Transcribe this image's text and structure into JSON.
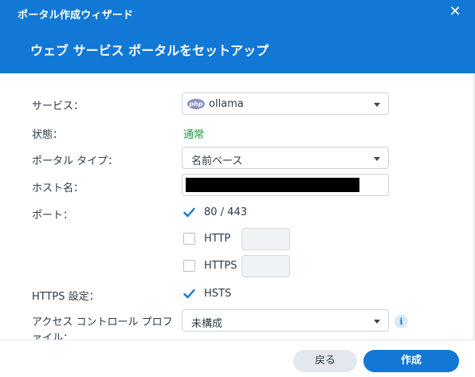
{
  "window": {
    "title": "ポータル作成ウィザード",
    "close_glyph": "✕"
  },
  "header": {
    "heading": "ウェブ サービス ポータルをセットアップ"
  },
  "form": {
    "service": {
      "label": "サービス：",
      "value": "ollama",
      "icon_text": "php",
      "icon": "php-icon"
    },
    "status": {
      "label": "状態：",
      "value": "通常"
    },
    "portal_type": {
      "label": "ポータル タイプ：",
      "value": "名前ベース"
    },
    "hostname": {
      "label": "ホスト名："
    },
    "port": {
      "label": "ポート：",
      "options": [
        {
          "label": "80 / 443",
          "checked": true
        },
        {
          "label": "HTTP",
          "checked": false
        },
        {
          "label": "HTTPS",
          "checked": false
        }
      ]
    },
    "https_settings": {
      "label": "HTTPS 設定：",
      "option": {
        "label": "HSTS",
        "checked": true
      }
    },
    "access_control": {
      "label": "アクセス コントロール プロファイル：",
      "value": "未構成",
      "info_glyph": "i"
    }
  },
  "footer": {
    "back_label": "戻る",
    "create_label": "作成"
  },
  "colors": {
    "accent": "#1178d6",
    "status_ok": "#1a9e3a"
  }
}
